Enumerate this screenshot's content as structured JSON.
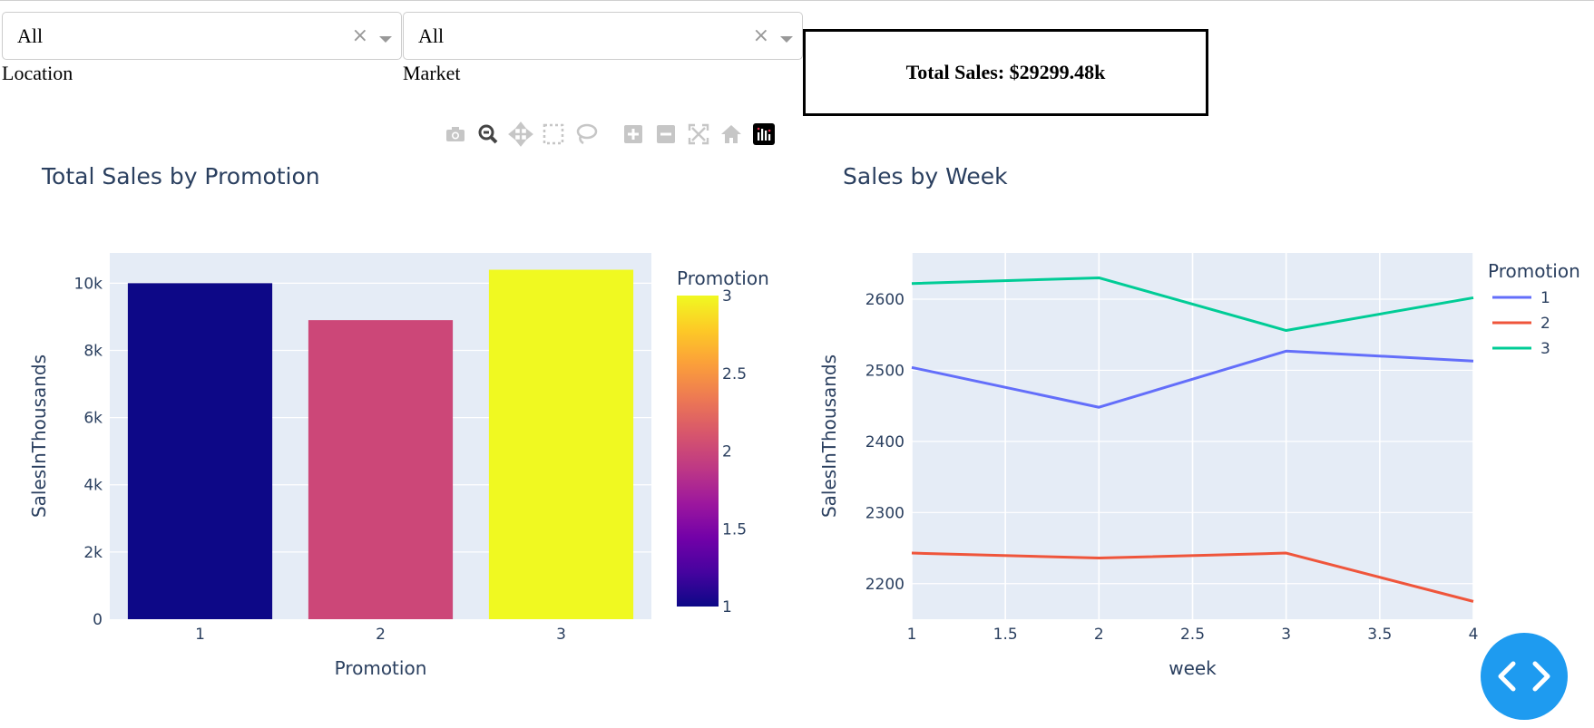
{
  "filters": {
    "location": {
      "value": "All",
      "label": "Location",
      "clear": "×"
    },
    "market": {
      "value": "All",
      "label": "Market",
      "clear": "×"
    }
  },
  "total_sales": "Total Sales: $29299.48k",
  "modebar_icons": [
    "camera-icon",
    "zoom-icon",
    "pan-icon",
    "box-select-icon",
    "lasso-icon",
    "zoom-in-icon",
    "zoom-out-icon",
    "autoscale-icon",
    "reset-axes-icon",
    "plotly-logo-icon"
  ],
  "chart_data": [
    {
      "type": "bar",
      "title": "Total Sales by Promotion",
      "xlabel": "Promotion",
      "ylabel": "SalesInThousands",
      "categories": [
        "1",
        "2",
        "3"
      ],
      "values": [
        10000,
        8900,
        10400
      ],
      "colors": [
        "#0d0887",
        "#cc4778",
        "#f0f921"
      ],
      "ylim": [
        0,
        10900
      ],
      "yticks": [
        0,
        2000,
        4000,
        6000,
        8000,
        10000
      ],
      "ytick_labels": [
        "0",
        "2k",
        "4k",
        "6k",
        "8k",
        "10k"
      ],
      "colorbar": {
        "title": "Promotion",
        "range": [
          1,
          3
        ],
        "ticks": [
          "1",
          "1.5",
          "2",
          "2.5",
          "3"
        ]
      },
      "background": "#e5ecf6",
      "grid": true
    },
    {
      "type": "line",
      "title": "Sales by Week",
      "xlabel": "week",
      "ylabel": "SalesInThousands",
      "legend_title": "Promotion",
      "legend_position": "top-right",
      "x": [
        1,
        2,
        3,
        4
      ],
      "xlim": [
        1,
        4
      ],
      "xticks": [
        "1",
        "1.5",
        "2",
        "2.5",
        "3",
        "3.5",
        "4"
      ],
      "ylim": [
        2150,
        2665
      ],
      "yticks": [
        "2200",
        "2300",
        "2400",
        "2500",
        "2600"
      ],
      "series": [
        {
          "name": "1",
          "color": "#636efa",
          "values": [
            2504,
            2448,
            2527,
            2513
          ]
        },
        {
          "name": "2",
          "color": "#ef553b",
          "values": [
            2243,
            2236,
            2243,
            2175
          ]
        },
        {
          "name": "3",
          "color": "#00cc96",
          "values": [
            2622,
            2630,
            2556,
            2602
          ]
        }
      ],
      "background": "#e5ecf6",
      "grid": true
    }
  ]
}
